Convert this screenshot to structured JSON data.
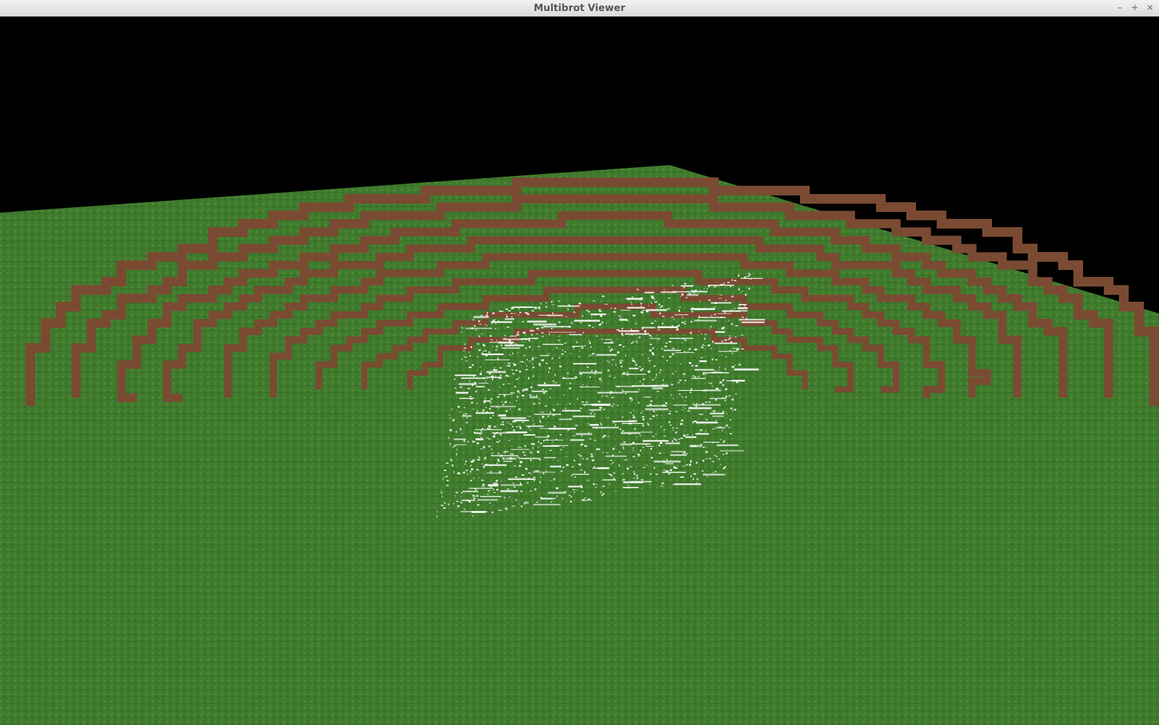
{
  "window": {
    "title": "Multibrot Viewer",
    "buttons": {
      "minimize": "–",
      "maximize": "+",
      "close": "×"
    }
  },
  "scene": {
    "sky_color": "#000000",
    "grass_color": "#3f7a2d",
    "grass_light": "#4e8c36",
    "dirt_color": "#7a4b32",
    "fractal_color": "#ffffff",
    "terrace_count": 9
  }
}
